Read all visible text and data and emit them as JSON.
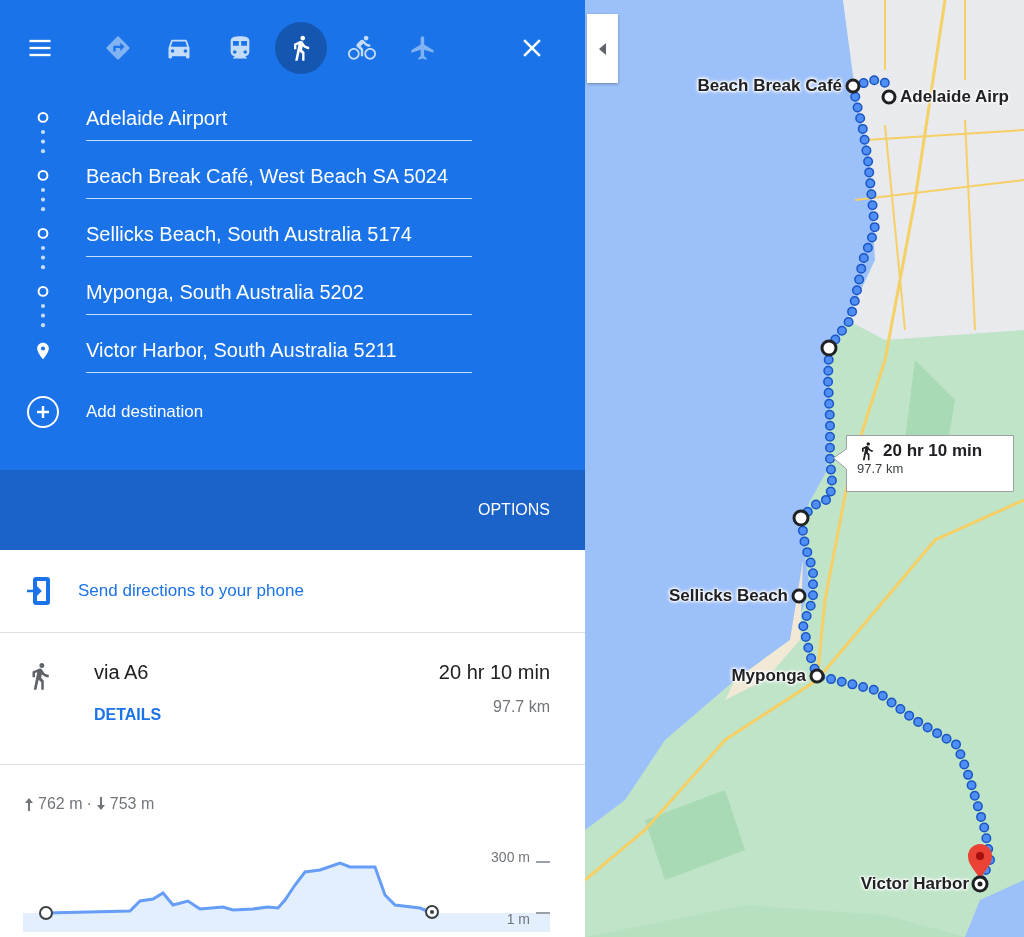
{
  "header": {
    "travel_modes": [
      {
        "kind": "best",
        "selected": false
      },
      {
        "kind": "driving",
        "selected": false
      },
      {
        "kind": "transit",
        "selected": false
      },
      {
        "kind": "walking",
        "selected": true
      },
      {
        "kind": "cycling",
        "selected": false
      },
      {
        "kind": "flights",
        "selected": false
      }
    ]
  },
  "waypoints": [
    {
      "kind": "stop",
      "value": "Adelaide Airport"
    },
    {
      "kind": "stop",
      "value": "Beach Break Café, West Beach SA 5024"
    },
    {
      "kind": "stop",
      "value": "Sellicks Beach, South Australia 5174"
    },
    {
      "kind": "stop",
      "value": "Myponga, South Australia 5202"
    },
    {
      "kind": "destination",
      "value": "Victor Harbor, South Australia 5211"
    }
  ],
  "add_destination": "Add destination",
  "options": "OPTIONS",
  "send_to_phone": "Send directions to your phone",
  "route": {
    "via": "via A6",
    "duration": "20 hr 10 min",
    "distance": "97.7 km",
    "details": "DETAILS"
  },
  "elevation": {
    "ascent": "762 m",
    "separator": "·",
    "descent": "753 m",
    "top_tick": "300 m",
    "bottom_tick": "1 m"
  },
  "map": {
    "markers": [
      {
        "kind": "stop",
        "label": "Beach Break Café"
      },
      {
        "kind": "stop",
        "label": "Adelaide Airp"
      },
      {
        "kind": "stop",
        "label": "Sellicks Beach"
      },
      {
        "kind": "stop",
        "label": "Myponga"
      },
      {
        "kind": "destination",
        "label": "Victor Harbor"
      }
    ],
    "callout": {
      "duration": "20 hr 10 min",
      "distance": "97.7 km"
    }
  }
}
